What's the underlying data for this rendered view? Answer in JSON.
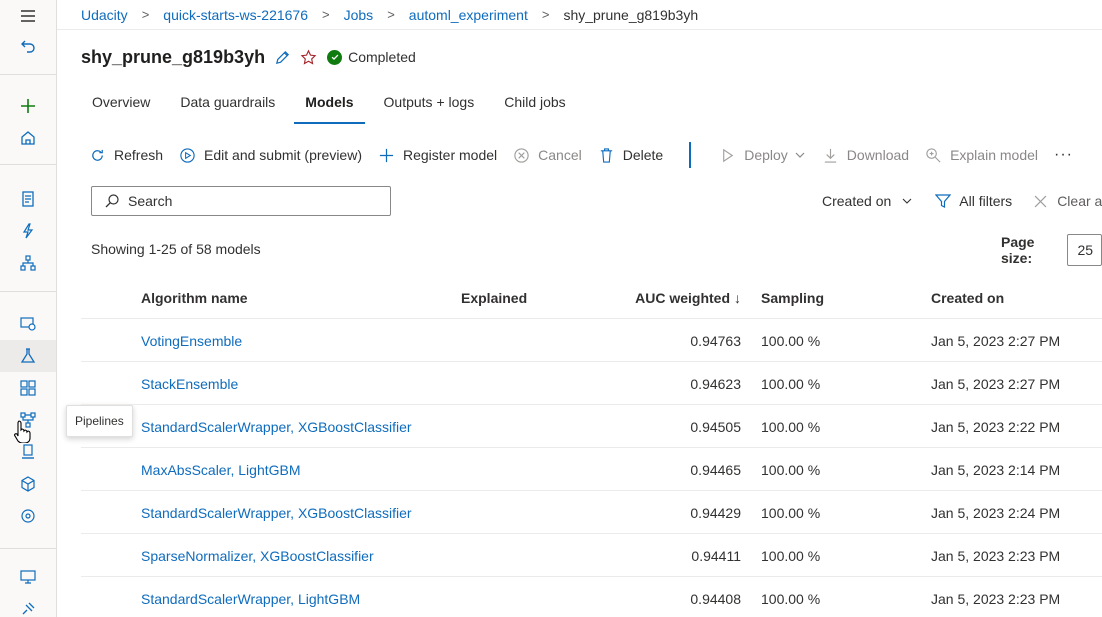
{
  "breadcrumb": {
    "items": [
      "Udacity",
      "quick-starts-ws-221676",
      "Jobs",
      "automl_experiment"
    ],
    "current": "shy_prune_g819b3yh",
    "separator": ">"
  },
  "header": {
    "title": "shy_prune_g819b3yh",
    "status": "Completed"
  },
  "tabs": [
    "Overview",
    "Data guardrails",
    "Models",
    "Outputs + logs",
    "Child jobs"
  ],
  "toolbar": {
    "refresh": "Refresh",
    "edit_submit": "Edit and submit (preview)",
    "register_model": "Register model",
    "cancel": "Cancel",
    "delete": "Delete",
    "deploy": "Deploy",
    "download": "Download",
    "explain_model": "Explain model",
    "more": "···"
  },
  "search": {
    "placeholder": "Search"
  },
  "filters": {
    "sort": "Created on",
    "all_filters": "All filters",
    "clear_all": "Clear al"
  },
  "showing": "Showing 1-25 of 58 models",
  "page_size": {
    "label": "Page size:",
    "value": "25"
  },
  "table": {
    "headers": {
      "algorithm": "Algorithm name",
      "explained": "Explained",
      "auc": "AUC weighted",
      "sort_arrow": "↓",
      "sampling": "Sampling",
      "created": "Created on"
    },
    "rows": [
      {
        "algorithm": "VotingEnsemble",
        "explained": "",
        "auc": "0.94763",
        "sampling": "100.00 %",
        "created": "Jan 5, 2023 2:27 PM"
      },
      {
        "algorithm": "StackEnsemble",
        "explained": "",
        "auc": "0.94623",
        "sampling": "100.00 %",
        "created": "Jan 5, 2023 2:27 PM"
      },
      {
        "algorithm": "StandardScalerWrapper, XGBoostClassifier",
        "explained": "",
        "auc": "0.94505",
        "sampling": "100.00 %",
        "created": "Jan 5, 2023 2:22 PM"
      },
      {
        "algorithm": "MaxAbsScaler, LightGBM",
        "explained": "",
        "auc": "0.94465",
        "sampling": "100.00 %",
        "created": "Jan 5, 2023 2:14 PM"
      },
      {
        "algorithm": "StandardScalerWrapper, XGBoostClassifier",
        "explained": "",
        "auc": "0.94429",
        "sampling": "100.00 %",
        "created": "Jan 5, 2023 2:24 PM"
      },
      {
        "algorithm": "SparseNormalizer, XGBoostClassifier",
        "explained": "",
        "auc": "0.94411",
        "sampling": "100.00 %",
        "created": "Jan 5, 2023 2:23 PM"
      },
      {
        "algorithm": "StandardScalerWrapper, LightGBM",
        "explained": "",
        "auc": "0.94408",
        "sampling": "100.00 %",
        "created": "Jan 5, 2023 2:23 PM"
      }
    ]
  },
  "tooltip": "Pipelines",
  "colors": {
    "accent": "#0f6cbd",
    "success": "#107c10",
    "favorite": "#a4262c",
    "add": "#107c10"
  }
}
